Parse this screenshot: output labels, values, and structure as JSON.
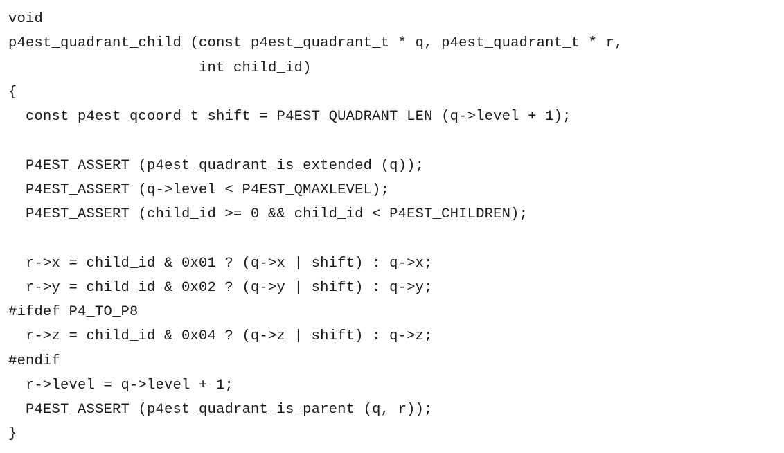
{
  "code": {
    "lines": [
      "void",
      "p4est_quadrant_child (const p4est_quadrant_t * q, p4est_quadrant_t * r,",
      "                      int child_id)",
      "{",
      "  const p4est_qcoord_t shift = P4EST_QUADRANT_LEN (q->level + 1);",
      "",
      "  P4EST_ASSERT (p4est_quadrant_is_extended (q));",
      "  P4EST_ASSERT (q->level < P4EST_QMAXLEVEL);",
      "  P4EST_ASSERT (child_id >= 0 && child_id < P4EST_CHILDREN);",
      "",
      "  r->x = child_id & 0x01 ? (q->x | shift) : q->x;",
      "  r->y = child_id & 0x02 ? (q->y | shift) : q->y;",
      "#ifdef P4_TO_P8",
      "  r->z = child_id & 0x04 ? (q->z | shift) : q->z;",
      "#endif",
      "  r->level = q->level + 1;",
      "  P4EST_ASSERT (p4est_quadrant_is_parent (q, r));",
      "}"
    ]
  }
}
